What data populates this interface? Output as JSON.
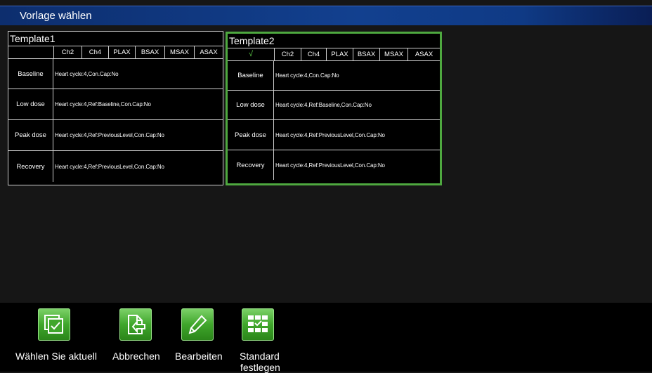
{
  "window": {
    "title": "Vorlage wählen"
  },
  "template1": {
    "name": "Template1",
    "selected": false,
    "check": "",
    "columns": [
      "Ch2",
      "Ch4",
      "PLAX",
      "BSAX",
      "MSAX",
      "ASAX"
    ],
    "rows": [
      {
        "label": "Baseline",
        "desc": "Heart cycle:4,Con.Cap:No"
      },
      {
        "label": "Low dose",
        "desc": "Heart cycle:4,Ref:Baseline,Con.Cap:No"
      },
      {
        "label": "Peak dose",
        "desc": "Heart cycle:4,Ref:PreviousLevel,Con.Cap:No"
      },
      {
        "label": "Recovery",
        "desc": "Heart cycle:4,Ref:PreviousLevel,Con.Cap:No"
      }
    ]
  },
  "template2": {
    "name": "Template2",
    "selected": true,
    "check": "√",
    "columns": [
      "Ch2",
      "Ch4",
      "PLAX",
      "BSAX",
      "MSAX",
      "ASAX"
    ],
    "rows": [
      {
        "label": "Baseline",
        "desc": "Heart cycle:4,Con.Cap:No"
      },
      {
        "label": "Low dose",
        "desc": "Heart cycle:4,Ref:Baseline,Con.Cap:No"
      },
      {
        "label": "Peak dose",
        "desc": "Heart cycle:4,Ref:PreviousLevel,Con.Cap:No"
      },
      {
        "label": "Recovery",
        "desc": "Heart cycle:4,Ref:PreviousLevel,Con.Cap:No"
      }
    ]
  },
  "toolbar": {
    "select_label": "Wählen Sie aktuell",
    "cancel_label": "Abbrechen",
    "edit_label": "Bearbeiten",
    "default_label_line1": "Standard",
    "default_label_line2": "festlegen"
  },
  "colors": {
    "accent_green": "#4ea83f",
    "title_blue": "#12408f",
    "check_green": "#5fd14a"
  },
  "icons": {
    "select": "select-current-icon",
    "cancel": "cancel-icon",
    "edit": "pencil-icon",
    "default": "grid-check-icon"
  }
}
